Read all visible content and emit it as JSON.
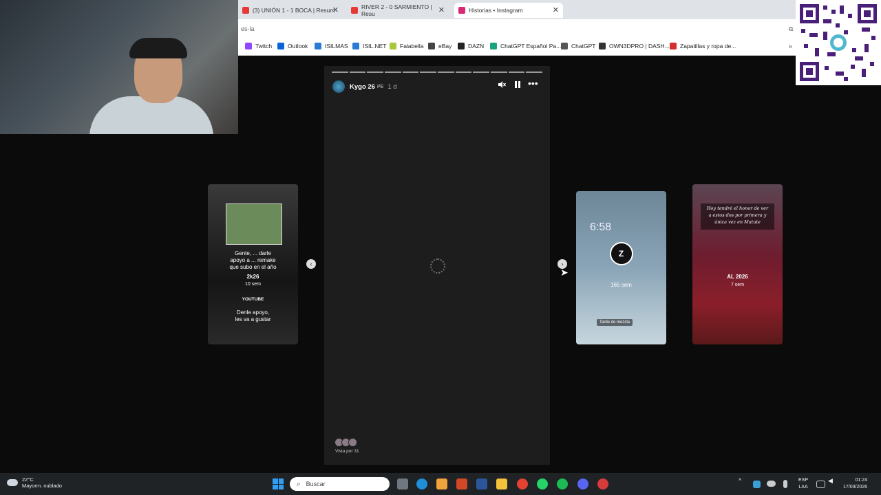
{
  "browser": {
    "tabs": [
      {
        "label": "(3) UNIÓN 1 - 1 BOCA | Resum",
        "color": "#e53935"
      },
      {
        "label": "RIVER 2 - 0 SARMIENTO | Resu",
        "color": "#e53935"
      },
      {
        "label": "Historias • Instagram",
        "color": "#d62976"
      }
    ],
    "address": "es-la",
    "bookmarks": [
      {
        "label": "Twitch",
        "color": "#9146ff"
      },
      {
        "label": "Outlook",
        "color": "#0a64d6"
      },
      {
        "label": "ISILMAS",
        "color": "#2b7bd4"
      },
      {
        "label": "ISIL.NET",
        "color": "#2b7bd4"
      },
      {
        "label": "Falabella",
        "color": "#a8c83a"
      },
      {
        "label": "eBay",
        "color": "#444444"
      },
      {
        "label": "DAZN",
        "color": "#222222"
      },
      {
        "label": "ChatGPT Español Pa...",
        "color": "#19a37f"
      },
      {
        "label": "ChatGPT",
        "color": "#555555"
      },
      {
        "label": "OWN3DPRO | DASH...",
        "color": "#333333"
      },
      {
        "label": "Zapatillas y ropa de...",
        "color": "#d32f2f"
      }
    ]
  },
  "story": {
    "username": "Kygo 26",
    "badge": "PE",
    "time": "1 d",
    "segments": 12,
    "viewers": "Vista por 31"
  },
  "cards": {
    "left": {
      "lines": [
        "Gente, ... darle",
        "apoyo a ... remake",
        "que subo en el año",
        "2k26",
        "10 sem",
        "YOUTUBE",
        "Denle apoyo,",
        "les va a gustar"
      ]
    },
    "right1": {
      "clock": "6:58",
      "ring_letter": "Z",
      "meta": "165 sem",
      "tag": "Tarde de mezcla"
    },
    "right2": {
      "title_lines": [
        "Hoy tendré el honor de ver",
        "a estos dos por primera y",
        "única vez en Matute"
      ],
      "ring_text": "AL 2026",
      "meta": "7 sem"
    }
  },
  "taskbar": {
    "weather_temp": "22°C",
    "weather_desc": "Mayorm. nublado",
    "search_placeholder": "Buscar",
    "lang": "ESP",
    "lang2": "LAA",
    "time": "01:24",
    "date": "17/03/2026"
  }
}
